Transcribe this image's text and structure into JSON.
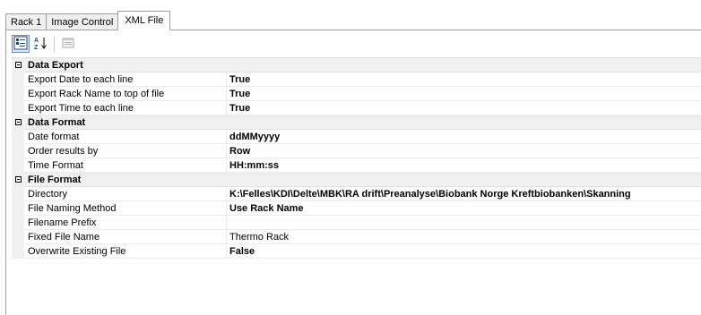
{
  "tabs": [
    {
      "label": "Rack 1",
      "active": false
    },
    {
      "label": "Image Control",
      "active": false
    },
    {
      "label": "XML File",
      "active": true
    }
  ],
  "toolbar": {
    "categorized_icon": "categorized-icon",
    "alphabetical_icon": "sort-az-icon",
    "property_pages_icon": "property-pages-icon"
  },
  "categories": [
    {
      "name": "Data Export",
      "properties": [
        {
          "name": "Export Date to each line",
          "value": "True",
          "bold": true
        },
        {
          "name": "Export Rack Name to top of file",
          "value": "True",
          "bold": true
        },
        {
          "name": "Export Time to each line",
          "value": "True",
          "bold": true
        }
      ]
    },
    {
      "name": "Data Format",
      "properties": [
        {
          "name": "Date format",
          "value": "ddMMyyyy",
          "bold": true
        },
        {
          "name": "Order results by",
          "value": "Row",
          "bold": true
        },
        {
          "name": "Time Format",
          "value": "HH:mm:ss",
          "bold": true
        }
      ]
    },
    {
      "name": "File Format",
      "properties": [
        {
          "name": "Directory",
          "value": "K:\\Felles\\KDI\\Delte\\MBK\\RA drift\\Preanalyse\\Biobank Norge Kreftbiobanken\\Skanning",
          "bold": true
        },
        {
          "name": "File Naming Method",
          "value": "Use Rack Name",
          "bold": true
        },
        {
          "name": "Filename Prefix",
          "value": "",
          "bold": false
        },
        {
          "name": "Fixed File Name",
          "value": "Thermo Rack",
          "bold": false
        },
        {
          "name": "Overwrite Existing File",
          "value": "False",
          "bold": true
        }
      ]
    }
  ]
}
